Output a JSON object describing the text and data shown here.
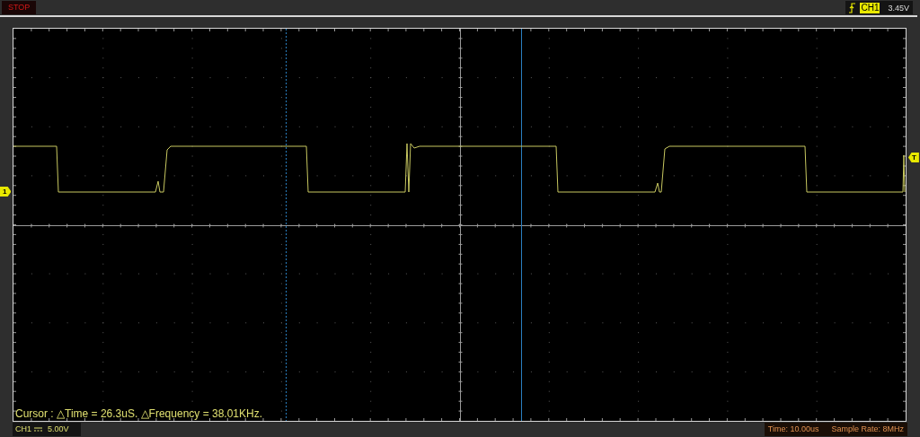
{
  "toolbar": {
    "run_state": "STOP",
    "trigger": {
      "channel": "CH1",
      "level": "3.45V"
    }
  },
  "screen": {
    "channel_marker": "1",
    "trigger_marker": "T",
    "cursor_readout": "Cursor : △Time = 26.3uS. △Frequency = 38.01KHz."
  },
  "status_bar": {
    "channel": "CH1",
    "scale": "5.00V",
    "time": "Time: 10.00us",
    "sample_rate": "Sample Rate: 8MHz"
  }
}
